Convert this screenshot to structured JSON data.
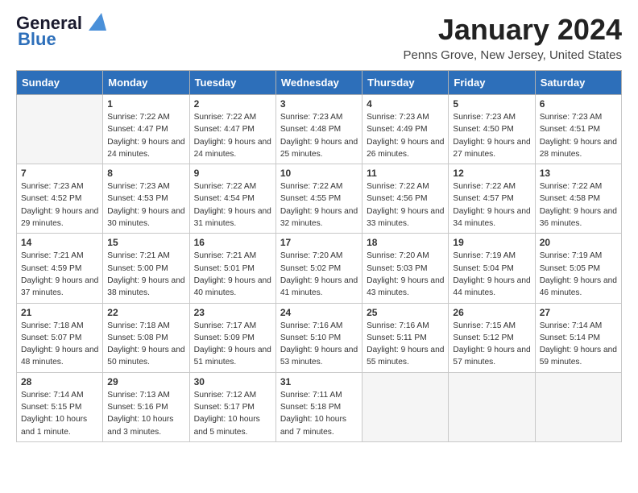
{
  "logo": {
    "line1": "General",
    "line2": "Blue"
  },
  "title": "January 2024",
  "subtitle": "Penns Grove, New Jersey, United States",
  "headers": [
    "Sunday",
    "Monday",
    "Tuesday",
    "Wednesday",
    "Thursday",
    "Friday",
    "Saturday"
  ],
  "weeks": [
    [
      {
        "day": "",
        "sunrise": "",
        "sunset": "",
        "daylight": ""
      },
      {
        "day": "1",
        "sunrise": "Sunrise: 7:22 AM",
        "sunset": "Sunset: 4:47 PM",
        "daylight": "Daylight: 9 hours and 24 minutes."
      },
      {
        "day": "2",
        "sunrise": "Sunrise: 7:22 AM",
        "sunset": "Sunset: 4:47 PM",
        "daylight": "Daylight: 9 hours and 24 minutes."
      },
      {
        "day": "3",
        "sunrise": "Sunrise: 7:23 AM",
        "sunset": "Sunset: 4:48 PM",
        "daylight": "Daylight: 9 hours and 25 minutes."
      },
      {
        "day": "4",
        "sunrise": "Sunrise: 7:23 AM",
        "sunset": "Sunset: 4:49 PM",
        "daylight": "Daylight: 9 hours and 26 minutes."
      },
      {
        "day": "5",
        "sunrise": "Sunrise: 7:23 AM",
        "sunset": "Sunset: 4:50 PM",
        "daylight": "Daylight: 9 hours and 27 minutes."
      },
      {
        "day": "6",
        "sunrise": "Sunrise: 7:23 AM",
        "sunset": "Sunset: 4:51 PM",
        "daylight": "Daylight: 9 hours and 28 minutes."
      }
    ],
    [
      {
        "day": "7",
        "sunrise": "Sunrise: 7:23 AM",
        "sunset": "Sunset: 4:52 PM",
        "daylight": "Daylight: 9 hours and 29 minutes."
      },
      {
        "day": "8",
        "sunrise": "Sunrise: 7:23 AM",
        "sunset": "Sunset: 4:53 PM",
        "daylight": "Daylight: 9 hours and 30 minutes."
      },
      {
        "day": "9",
        "sunrise": "Sunrise: 7:22 AM",
        "sunset": "Sunset: 4:54 PM",
        "daylight": "Daylight: 9 hours and 31 minutes."
      },
      {
        "day": "10",
        "sunrise": "Sunrise: 7:22 AM",
        "sunset": "Sunset: 4:55 PM",
        "daylight": "Daylight: 9 hours and 32 minutes."
      },
      {
        "day": "11",
        "sunrise": "Sunrise: 7:22 AM",
        "sunset": "Sunset: 4:56 PM",
        "daylight": "Daylight: 9 hours and 33 minutes."
      },
      {
        "day": "12",
        "sunrise": "Sunrise: 7:22 AM",
        "sunset": "Sunset: 4:57 PM",
        "daylight": "Daylight: 9 hours and 34 minutes."
      },
      {
        "day": "13",
        "sunrise": "Sunrise: 7:22 AM",
        "sunset": "Sunset: 4:58 PM",
        "daylight": "Daylight: 9 hours and 36 minutes."
      }
    ],
    [
      {
        "day": "14",
        "sunrise": "Sunrise: 7:21 AM",
        "sunset": "Sunset: 4:59 PM",
        "daylight": "Daylight: 9 hours and 37 minutes."
      },
      {
        "day": "15",
        "sunrise": "Sunrise: 7:21 AM",
        "sunset": "Sunset: 5:00 PM",
        "daylight": "Daylight: 9 hours and 38 minutes."
      },
      {
        "day": "16",
        "sunrise": "Sunrise: 7:21 AM",
        "sunset": "Sunset: 5:01 PM",
        "daylight": "Daylight: 9 hours and 40 minutes."
      },
      {
        "day": "17",
        "sunrise": "Sunrise: 7:20 AM",
        "sunset": "Sunset: 5:02 PM",
        "daylight": "Daylight: 9 hours and 41 minutes."
      },
      {
        "day": "18",
        "sunrise": "Sunrise: 7:20 AM",
        "sunset": "Sunset: 5:03 PM",
        "daylight": "Daylight: 9 hours and 43 minutes."
      },
      {
        "day": "19",
        "sunrise": "Sunrise: 7:19 AM",
        "sunset": "Sunset: 5:04 PM",
        "daylight": "Daylight: 9 hours and 44 minutes."
      },
      {
        "day": "20",
        "sunrise": "Sunrise: 7:19 AM",
        "sunset": "Sunset: 5:05 PM",
        "daylight": "Daylight: 9 hours and 46 minutes."
      }
    ],
    [
      {
        "day": "21",
        "sunrise": "Sunrise: 7:18 AM",
        "sunset": "Sunset: 5:07 PM",
        "daylight": "Daylight: 9 hours and 48 minutes."
      },
      {
        "day": "22",
        "sunrise": "Sunrise: 7:18 AM",
        "sunset": "Sunset: 5:08 PM",
        "daylight": "Daylight: 9 hours and 50 minutes."
      },
      {
        "day": "23",
        "sunrise": "Sunrise: 7:17 AM",
        "sunset": "Sunset: 5:09 PM",
        "daylight": "Daylight: 9 hours and 51 minutes."
      },
      {
        "day": "24",
        "sunrise": "Sunrise: 7:16 AM",
        "sunset": "Sunset: 5:10 PM",
        "daylight": "Daylight: 9 hours and 53 minutes."
      },
      {
        "day": "25",
        "sunrise": "Sunrise: 7:16 AM",
        "sunset": "Sunset: 5:11 PM",
        "daylight": "Daylight: 9 hours and 55 minutes."
      },
      {
        "day": "26",
        "sunrise": "Sunrise: 7:15 AM",
        "sunset": "Sunset: 5:12 PM",
        "daylight": "Daylight: 9 hours and 57 minutes."
      },
      {
        "day": "27",
        "sunrise": "Sunrise: 7:14 AM",
        "sunset": "Sunset: 5:14 PM",
        "daylight": "Daylight: 9 hours and 59 minutes."
      }
    ],
    [
      {
        "day": "28",
        "sunrise": "Sunrise: 7:14 AM",
        "sunset": "Sunset: 5:15 PM",
        "daylight": "Daylight: 10 hours and 1 minute."
      },
      {
        "day": "29",
        "sunrise": "Sunrise: 7:13 AM",
        "sunset": "Sunset: 5:16 PM",
        "daylight": "Daylight: 10 hours and 3 minutes."
      },
      {
        "day": "30",
        "sunrise": "Sunrise: 7:12 AM",
        "sunset": "Sunset: 5:17 PM",
        "daylight": "Daylight: 10 hours and 5 minutes."
      },
      {
        "day": "31",
        "sunrise": "Sunrise: 7:11 AM",
        "sunset": "Sunset: 5:18 PM",
        "daylight": "Daylight: 10 hours and 7 minutes."
      },
      {
        "day": "",
        "sunrise": "",
        "sunset": "",
        "daylight": ""
      },
      {
        "day": "",
        "sunrise": "",
        "sunset": "",
        "daylight": ""
      },
      {
        "day": "",
        "sunrise": "",
        "sunset": "",
        "daylight": ""
      }
    ]
  ]
}
